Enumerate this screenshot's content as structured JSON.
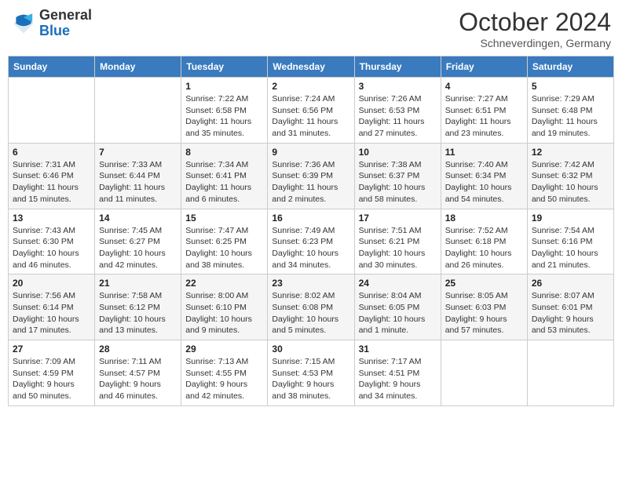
{
  "header": {
    "logo_general": "General",
    "logo_blue": "Blue",
    "month_title": "October 2024",
    "location": "Schneverdingen, Germany"
  },
  "weekdays": [
    "Sunday",
    "Monday",
    "Tuesday",
    "Wednesday",
    "Thursday",
    "Friday",
    "Saturday"
  ],
  "weeks": [
    [
      {
        "day": "",
        "info": ""
      },
      {
        "day": "",
        "info": ""
      },
      {
        "day": "1",
        "info": "Sunrise: 7:22 AM\nSunset: 6:58 PM\nDaylight: 11 hours and 35 minutes."
      },
      {
        "day": "2",
        "info": "Sunrise: 7:24 AM\nSunset: 6:56 PM\nDaylight: 11 hours and 31 minutes."
      },
      {
        "day": "3",
        "info": "Sunrise: 7:26 AM\nSunset: 6:53 PM\nDaylight: 11 hours and 27 minutes."
      },
      {
        "day": "4",
        "info": "Sunrise: 7:27 AM\nSunset: 6:51 PM\nDaylight: 11 hours and 23 minutes."
      },
      {
        "day": "5",
        "info": "Sunrise: 7:29 AM\nSunset: 6:48 PM\nDaylight: 11 hours and 19 minutes."
      }
    ],
    [
      {
        "day": "6",
        "info": "Sunrise: 7:31 AM\nSunset: 6:46 PM\nDaylight: 11 hours and 15 minutes."
      },
      {
        "day": "7",
        "info": "Sunrise: 7:33 AM\nSunset: 6:44 PM\nDaylight: 11 hours and 11 minutes."
      },
      {
        "day": "8",
        "info": "Sunrise: 7:34 AM\nSunset: 6:41 PM\nDaylight: 11 hours and 6 minutes."
      },
      {
        "day": "9",
        "info": "Sunrise: 7:36 AM\nSunset: 6:39 PM\nDaylight: 11 hours and 2 minutes."
      },
      {
        "day": "10",
        "info": "Sunrise: 7:38 AM\nSunset: 6:37 PM\nDaylight: 10 hours and 58 minutes."
      },
      {
        "day": "11",
        "info": "Sunrise: 7:40 AM\nSunset: 6:34 PM\nDaylight: 10 hours and 54 minutes."
      },
      {
        "day": "12",
        "info": "Sunrise: 7:42 AM\nSunset: 6:32 PM\nDaylight: 10 hours and 50 minutes."
      }
    ],
    [
      {
        "day": "13",
        "info": "Sunrise: 7:43 AM\nSunset: 6:30 PM\nDaylight: 10 hours and 46 minutes."
      },
      {
        "day": "14",
        "info": "Sunrise: 7:45 AM\nSunset: 6:27 PM\nDaylight: 10 hours and 42 minutes."
      },
      {
        "day": "15",
        "info": "Sunrise: 7:47 AM\nSunset: 6:25 PM\nDaylight: 10 hours and 38 minutes."
      },
      {
        "day": "16",
        "info": "Sunrise: 7:49 AM\nSunset: 6:23 PM\nDaylight: 10 hours and 34 minutes."
      },
      {
        "day": "17",
        "info": "Sunrise: 7:51 AM\nSunset: 6:21 PM\nDaylight: 10 hours and 30 minutes."
      },
      {
        "day": "18",
        "info": "Sunrise: 7:52 AM\nSunset: 6:18 PM\nDaylight: 10 hours and 26 minutes."
      },
      {
        "day": "19",
        "info": "Sunrise: 7:54 AM\nSunset: 6:16 PM\nDaylight: 10 hours and 21 minutes."
      }
    ],
    [
      {
        "day": "20",
        "info": "Sunrise: 7:56 AM\nSunset: 6:14 PM\nDaylight: 10 hours and 17 minutes."
      },
      {
        "day": "21",
        "info": "Sunrise: 7:58 AM\nSunset: 6:12 PM\nDaylight: 10 hours and 13 minutes."
      },
      {
        "day": "22",
        "info": "Sunrise: 8:00 AM\nSunset: 6:10 PM\nDaylight: 10 hours and 9 minutes."
      },
      {
        "day": "23",
        "info": "Sunrise: 8:02 AM\nSunset: 6:08 PM\nDaylight: 10 hours and 5 minutes."
      },
      {
        "day": "24",
        "info": "Sunrise: 8:04 AM\nSunset: 6:05 PM\nDaylight: 10 hours and 1 minute."
      },
      {
        "day": "25",
        "info": "Sunrise: 8:05 AM\nSunset: 6:03 PM\nDaylight: 9 hours and 57 minutes."
      },
      {
        "day": "26",
        "info": "Sunrise: 8:07 AM\nSunset: 6:01 PM\nDaylight: 9 hours and 53 minutes."
      }
    ],
    [
      {
        "day": "27",
        "info": "Sunrise: 7:09 AM\nSunset: 4:59 PM\nDaylight: 9 hours and 50 minutes."
      },
      {
        "day": "28",
        "info": "Sunrise: 7:11 AM\nSunset: 4:57 PM\nDaylight: 9 hours and 46 minutes."
      },
      {
        "day": "29",
        "info": "Sunrise: 7:13 AM\nSunset: 4:55 PM\nDaylight: 9 hours and 42 minutes."
      },
      {
        "day": "30",
        "info": "Sunrise: 7:15 AM\nSunset: 4:53 PM\nDaylight: 9 hours and 38 minutes."
      },
      {
        "day": "31",
        "info": "Sunrise: 7:17 AM\nSunset: 4:51 PM\nDaylight: 9 hours and 34 minutes."
      },
      {
        "day": "",
        "info": ""
      },
      {
        "day": "",
        "info": ""
      }
    ]
  ]
}
